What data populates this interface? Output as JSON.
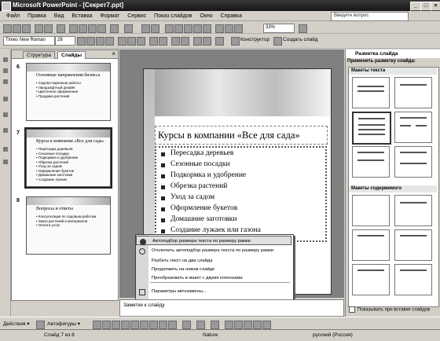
{
  "window": {
    "title": "Microsoft PowerPoint - [Секрет7.ppt]"
  },
  "menu": [
    "Файл",
    "Правка",
    "Вид",
    "Вставка",
    "Формат",
    "Сервис",
    "Показ слайдов",
    "Окно",
    "Справка"
  ],
  "help_box": "Введите вопрос",
  "formatting": {
    "font": "Times New Roman",
    "size": "28",
    "zoom": "33%"
  },
  "toolbar_labels": {
    "designer": "Конструктор",
    "new_slide": "Создать слайд"
  },
  "outline_tabs": [
    "Структура",
    "Слайды"
  ],
  "thumbnails": [
    {
      "num": "6",
      "title": "Основные направления бизнеса",
      "bullets": [
        "Садово-парковые работы",
        "Ландшафтный дизайн",
        "Цветочное оформление",
        "Продажа растений"
      ]
    },
    {
      "num": "7",
      "title": "Курсы в компании «Все для сада»",
      "bullets": [
        "Пересадка деревьев",
        "Сезонные посадки",
        "Подкормка и удобрение",
        "Обрезка растений",
        "Уход за садом",
        "Оформление букетов",
        "Домашние заготовки",
        "Создание лужаек"
      ]
    },
    {
      "num": "8",
      "title": "Вопросы и ответы",
      "bullets": [
        "Консультация по садовым работам",
        "Заказ растений и материалов",
        "Оплата услуг"
      ]
    }
  ],
  "slide": {
    "title": "Курсы в компании «Все для сада»",
    "bullets": [
      "Пересадка деревьев",
      "Сезонные посадки",
      "Подкормка и удобрение",
      "Обрезка растений",
      "Уход за садом",
      "Оформление букетов",
      "Домашние заготовки",
      "Создание лужаек или газона"
    ]
  },
  "context_menu": [
    "Автоподбор размера текста по размеру рамки",
    "Отключить автоподбор размера текста по размеру рамки",
    "Разбить текст на два слайда",
    "Продолжить на новом слайде",
    "Преобразовать в макет с двумя колонками",
    "Параметры автозамены..."
  ],
  "notes_placeholder": "Заметки к слайду",
  "task_pane": {
    "title": "Разметка слайда",
    "subtitle": "Применить разметку слайда:",
    "sections": [
      "Макеты текста",
      "Макеты содержимого"
    ],
    "checkbox": "Показывать при вставке слайдов"
  },
  "draw_toolbar": {
    "actions": "Действия ▾",
    "autoshapes": "Автофигуры ▾"
  },
  "status": {
    "slide": "Слайд 7 из 8",
    "design": "Nature",
    "language": "русский (Россия)"
  }
}
